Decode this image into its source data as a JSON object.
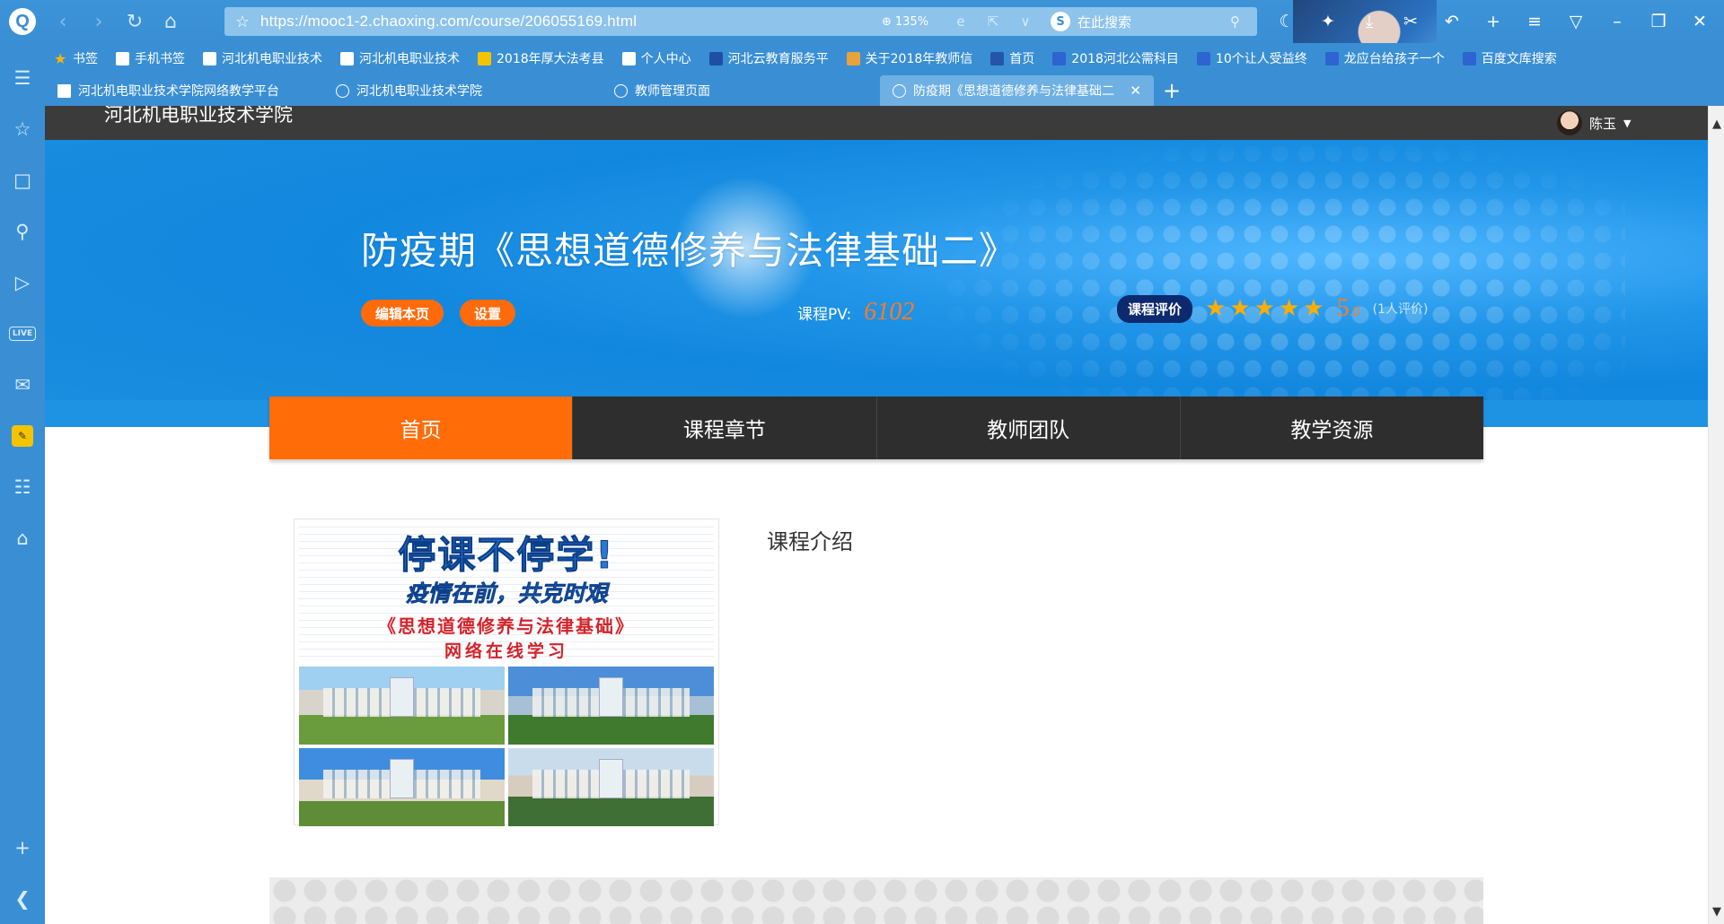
{
  "browser": {
    "url": "https://mooc1-2.chaoxing.com/course/206055169.html",
    "zoom": "135%",
    "search_placeholder": "在此搜索",
    "bookmarks": [
      {
        "label": "书签",
        "color": "#ffb400"
      },
      {
        "label": "手机书签",
        "color": "#ffffff"
      },
      {
        "label": "河北机电职业技术",
        "color": "#ffffff"
      },
      {
        "label": "河北机电职业技术",
        "color": "#ffffff"
      },
      {
        "label": "2018年厚大法考县",
        "color": "#f5c400"
      },
      {
        "label": "个人中心",
        "color": "#ffffff"
      },
      {
        "label": "河北云教育服务平",
        "color": "#1f4fa5"
      },
      {
        "label": "关于2018年教师信",
        "color": "#e8a33a"
      },
      {
        "label": "首页",
        "color": "#2455a8"
      },
      {
        "label": "2018河北公需科目",
        "color": "#2d64d0"
      },
      {
        "label": "10个让人受益终",
        "color": "#2d64d0"
      },
      {
        "label": "龙应台给孩子一个",
        "color": "#2d64d0"
      },
      {
        "label": "百度文库搜索",
        "color": "#2d64d0"
      }
    ],
    "tabs": [
      {
        "label": "河北机电职业技术学院网络教学平台",
        "icon": "square"
      },
      {
        "label": "河北机电职业技术学院",
        "icon": "globe"
      },
      {
        "label": "教师管理页面",
        "icon": "globe"
      },
      {
        "label": "防疫期《思想道德修养与法律基础二",
        "icon": "globe",
        "active": true
      }
    ]
  },
  "page": {
    "school_name": "河北机电职业技术学院",
    "user_name": "陈玉",
    "course_title": "防疫期《思想道德修养与法律基础二》",
    "edit_button": "编辑本页",
    "settings_button": "设置",
    "pv_label": "课程PV:",
    "pv_value": "6102",
    "rating_badge": "课程评价",
    "rating_score": "5",
    "rating_decimal": ".0",
    "rating_count": "(1人评价)",
    "rating_stars": 5,
    "menu": [
      "首页",
      "课程章节",
      "教师团队",
      "教学资源"
    ],
    "active_menu_index": 0,
    "intro_heading": "课程介绍",
    "cover": {
      "line1": "停课不停学!",
      "line2": "疫情在前，共克时艰",
      "line3": "《思想道德修养与法律基础》",
      "line4": "网络在线学习"
    }
  },
  "colors": {
    "browser_blue": "#3a8fd4",
    "accent_orange": "#ff6c08",
    "menu_dark": "#2e2e2e",
    "badge_navy": "#0d2a6e",
    "star_gold": "#ffae00"
  }
}
